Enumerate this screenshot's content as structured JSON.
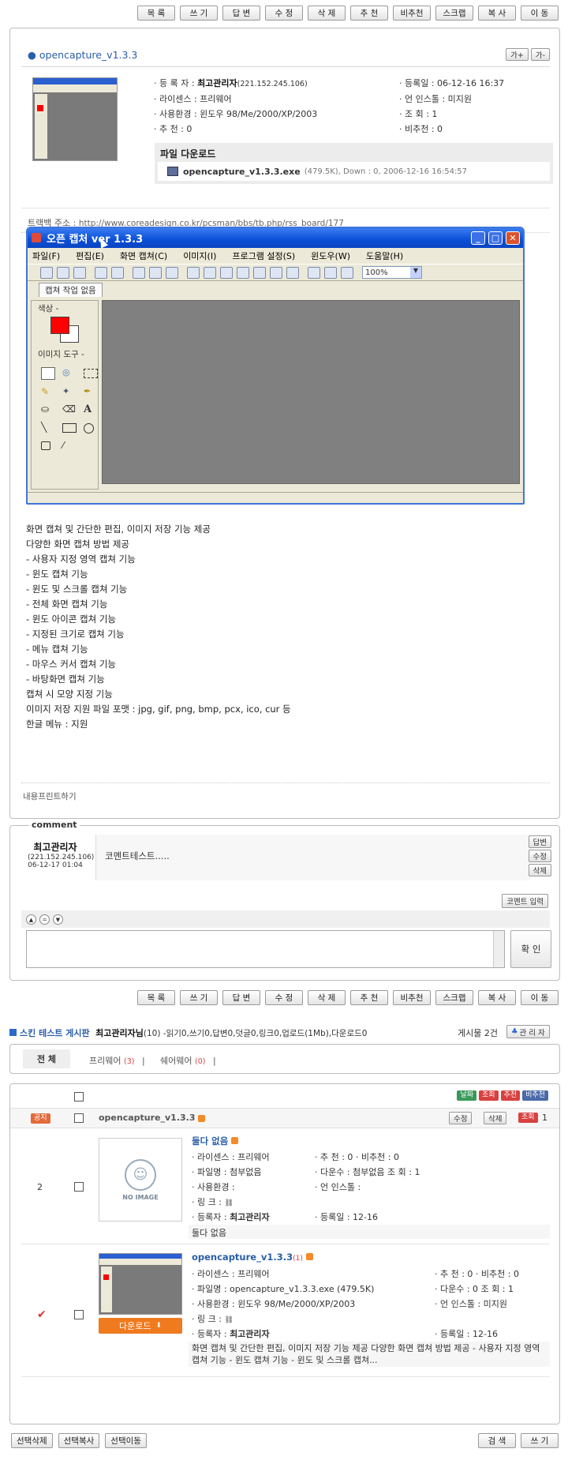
{
  "toolbar_buttons": [
    "목 록",
    "쓰 기",
    "답 변",
    "수 정",
    "삭 제",
    "추 천",
    "비추천",
    "스크랩",
    "복 사",
    "이 동"
  ],
  "post": {
    "title": "opencapture_v1.3.3",
    "font_buttons": [
      "가+",
      "가-"
    ],
    "registrant_label": "· 등 록 자 :",
    "registrant_name": "최고관리자",
    "registrant_ip": "(221.152.245.106)",
    "license": "· 라이센스 : 프리웨어",
    "os": "· 사용환경 : 윈도우 98/Me/2000/XP/2003",
    "recommend": "· 추      천 : 0",
    "date": "· 등록일 : 06-12-16 16:37",
    "lang": "· 언 인스톨 : 미지원",
    "views": "· 조      회 : 1",
    "non_recommend": "· 비추천 : 0",
    "download_heading": "파일 다운로드",
    "file_name": "opencapture_v1.3.3.exe",
    "file_info": "(479.5K), Down : 0, 2006-12-16 16:54:57",
    "trackback_label": "트랙백 주소 :",
    "trackback_url": "http://www.coreadesign.co.kr/pcsman/bbs/tb.php/rss_board/177",
    "print_link": "내용프린트하기"
  },
  "app_window": {
    "title": "오픈 캡처 ver 1.3.3",
    "menus": [
      "파일(F)",
      "편집(E)",
      "화면 캡쳐(C)",
      "이미지(I)",
      "프로그램 설정(S)",
      "윈도우(W)",
      "도움말(H)"
    ],
    "zoom": "100%",
    "tab": "캡쳐 작업 없음",
    "color_label": "색상 -",
    "tool_label": "이미지 도구 -",
    "fg_color": "#ff0000"
  },
  "description": [
    "화면 캡쳐 및 간단한 편집, 이미지 저장 기능 제공",
    "다양한 화면 캡쳐 방법 제공",
    "- 사용자 지정 영역 캡쳐 기능",
    "- 윈도 캡쳐 기능",
    "- 윈도 및 스크롤 캡쳐 기능",
    "- 전체 화면 캡쳐 기능",
    "- 윈도 아이콘 캡쳐 기능",
    "- 지정된 크기로 캡쳐 기능",
    "- 메뉴 캡쳐 기능",
    "- 마우스 커서 캡쳐 기능",
    "- 바탕화면 캡쳐 기능",
    "캡쳐 시 모양 지정 기능",
    "이미지 저장 지원 파일 포맷 : jpg, gif, png, bmp, pcx, ico, cur 등",
    "한글 메뉴 : 지원"
  ],
  "comment": {
    "heading": "comment",
    "author": "최고관리자",
    "ip": "(221.152.245.106)",
    "date": "06-12-17 01:04",
    "text": "코멘트테스트.....",
    "buttons": [
      "답변",
      "수정",
      "삭제"
    ],
    "input_button": "코멘트 입력",
    "confirm": "확 인"
  },
  "board": {
    "name": "스킨 테스트 게시판",
    "user": "최고관리자님",
    "stats": "(10) -읽기0,쓰기0,답변0,덧글0,링크0,업로드(1Mb),다운로드0",
    "count": "게시물 2건",
    "admin": "관 리 자",
    "cats": [
      {
        "label": "전   체",
        "count": ""
      },
      {
        "label": "프리웨어",
        "count": "(3)"
      },
      {
        "label": "쉐어웨어",
        "count": "(0)"
      }
    ],
    "sort_badges": [
      {
        "label": "날짜",
        "color": "#3a9a5a"
      },
      {
        "label": "조회",
        "color": "#d94040"
      },
      {
        "label": "추천",
        "color": "#d94040"
      },
      {
        "label": "비추천",
        "color": "#4a6aa8"
      }
    ],
    "notice_badge": "공지",
    "notice_title": "opencapture_v1.3.3",
    "notice_buttons": [
      "수정",
      "삭제",
      "조회"
    ],
    "notice_count": "1",
    "items": [
      {
        "num": "2",
        "title": "둘다 없음",
        "no_image": "NO IMAGE",
        "license": "· 라이센스 : 프리웨어",
        "file": "· 파일명 : 첨부없음",
        "os": "· 사용환경 :",
        "link": "· 링      크 :",
        "reg": "· 등록자 :",
        "reg_name": "최고관리자",
        "rec": "· 추      천 : 0 · 비추천 : 0",
        "down": "· 다운수 : 첨부없음    조      회 : 1",
        "uninst": "· 언 인스톨 :",
        "date": "· 등록일 : 12-16",
        "summary": "둘다 없음"
      },
      {
        "num": "",
        "title": "opencapture_v1.3.3",
        "title_count": "(1)",
        "license": "· 라이센스 : 프리웨어",
        "file": "· 파일명 : opencapture_v1.3.3.exe (479.5K)",
        "os": "· 사용환경 : 윈도우 98/Me/2000/XP/2003",
        "link": "· 링      크 :",
        "reg": "· 등록자 :",
        "reg_name": "최고관리자",
        "rec": "· 추      천 : 0 · 비추천 : 0",
        "down": "· 다운수 : 0    조      회 : 1",
        "uninst": "· 언 인스톨 : 미지원",
        "date": "· 등록일 : 12-16",
        "download_btn": "다운로드",
        "summary": "화면 캡쳐 및 간단한 편집, 이미지 저장 기능 제공 다양한 화면 캡쳐 방법 제공 - 사용자 지정 영역 캡쳐 기능 - 윈도 캡쳐 기능 - 윈도 및 스크롤 캡쳐..."
      }
    ],
    "bottom_left": [
      "선택삭제",
      "선택복사",
      "선택이동"
    ],
    "bottom_right": [
      "검 색",
      "쓰 기"
    ]
  }
}
